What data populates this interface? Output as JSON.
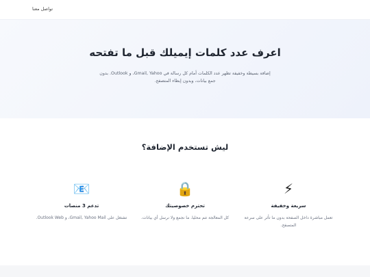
{
  "header": {
    "contact_link": "تواصل معنا"
  },
  "hero": {
    "title": "اعرف عدد كلمات إيميلك قبل ما تفتحه",
    "description": "إضافة بسيطة وخفيفة تظهر عدد الكلمات أمام كل رسالة في Gmail, Yahoo، و Outlook. بدون جمع بيانات، وبدون إبطاء المتصفح."
  },
  "features": {
    "heading": "ليش تستخدم الإضافة؟",
    "items": [
      {
        "icon": "lightning-icon",
        "glyph": "⚡",
        "title": "سريعة وخفيفة",
        "text": "تعمل مباشرة داخل الصفحة بدون ما تأثر على سرعة المتصفح."
      },
      {
        "icon": "lock-icon",
        "glyph": "🔒",
        "title": "تحترم خصوصيتك",
        "text": "كل المعالجة تتم محليا. ما نجمع ولا نرسل أي بيانات."
      },
      {
        "icon": "email-icon",
        "glyph": "📧",
        "title": "تدعم 3 منصات",
        "text": "تشتغل على Gmail, Yahoo Mail، و Outlook Web."
      }
    ]
  }
}
